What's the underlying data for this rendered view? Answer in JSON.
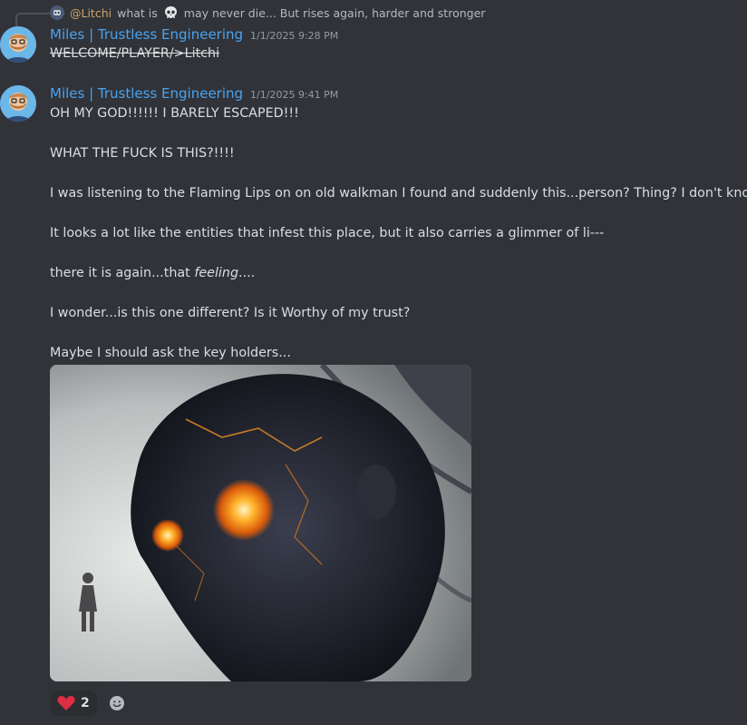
{
  "reply": {
    "username": "@Litchi",
    "text_before_emoji": "what is",
    "emoji": "skull-emoji",
    "text_after_emoji": "may never die...  But rises again, harder and stronger"
  },
  "messages": [
    {
      "username": "Miles | Trustless Engineering",
      "timestamp": "1/1/2025 9:28 PM",
      "content_strike": "WELCOME/PLAYER/>Litchi"
    },
    {
      "username": "Miles | Trustless Engineering",
      "timestamp": "1/1/2025 9:41 PM",
      "lines": [
        "OH MY GOD!!!!!! I BARELY ESCAPED!!!",
        "WHAT THE FUCK IS THIS?!!!!",
        "I was listening to the Flaming Lips on on old walkman I found and suddenly this...person? Thing? I don't know...",
        "It looks a lot like the entities that infest this place, but it also carries a glimmer of li---",
        "there it is again...that ",
        "feeling",
        "....",
        "I wonder...is this one different? Is it Worthy of my trust?",
        "Maybe I should ask the key holders..."
      ]
    }
  ],
  "reactions": [
    {
      "emoji": "heart-emoji",
      "count": "2"
    }
  ],
  "colors": {
    "background": "#313338",
    "username": "#4aa3f0",
    "reply_user": "#c9a46b",
    "text": "#dbdee1",
    "muted": "#949ba4",
    "heart": "#dd2e44"
  }
}
